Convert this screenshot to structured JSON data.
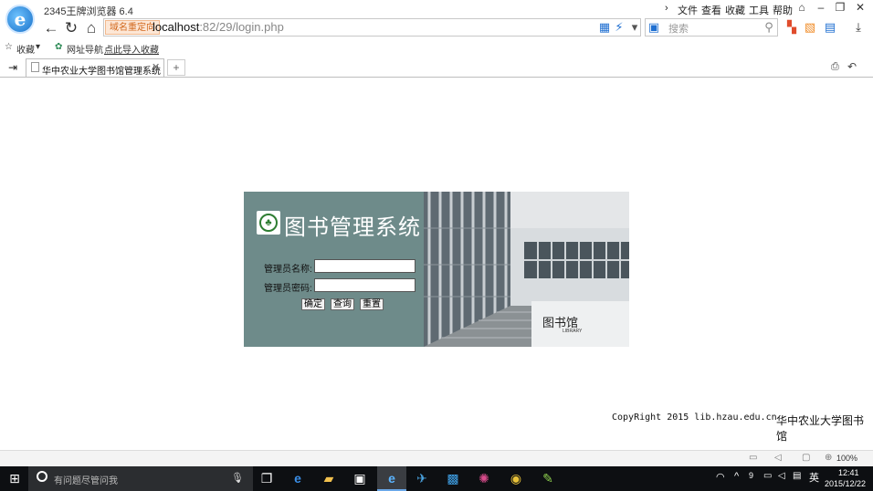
{
  "window": {
    "app_title": "2345王牌浏览器 6.4",
    "menu": [
      "文件",
      "查看",
      "收藏",
      "工具",
      "帮助"
    ],
    "window_buttons": [
      "minimize-icon",
      "restore-icon",
      "close-icon"
    ]
  },
  "address_bar": {
    "redirect_badge": "域名重定向",
    "url_host": "localhost",
    "url_rest": ":82/29/login.php",
    "search_placeholder": "搜索"
  },
  "bookmarks": {
    "favorites_label": "收藏",
    "items": [
      "网址导航",
      "点此导入收藏"
    ]
  },
  "tabs": [
    {
      "title": "华中农业大学图书馆管理系统",
      "active": true
    }
  ],
  "login": {
    "title": "图书管理系统",
    "username_label": "管理员名称:",
    "password_label": "管理员密码:",
    "username_value": "",
    "password_value": "",
    "buttons": {
      "confirm": "确定",
      "query": "查询",
      "reset": "重置"
    }
  },
  "photo": {
    "sign_text": "图书馆",
    "sign_subtext": "LIBRARY"
  },
  "footer": {
    "copyright": "CopyRight 2015 lib.hzau.edu.cn",
    "org": "华中农业大学图书馆"
  },
  "status_bar": {
    "zoom": "100%"
  },
  "taskbar": {
    "search_placeholder": "有问题尽管问我",
    "ime": "英",
    "time": "12:41",
    "date": "2015/12/22"
  },
  "colors": {
    "panel_bg": "#6e8b8a",
    "taskbar_bg": "#0d0f12"
  }
}
